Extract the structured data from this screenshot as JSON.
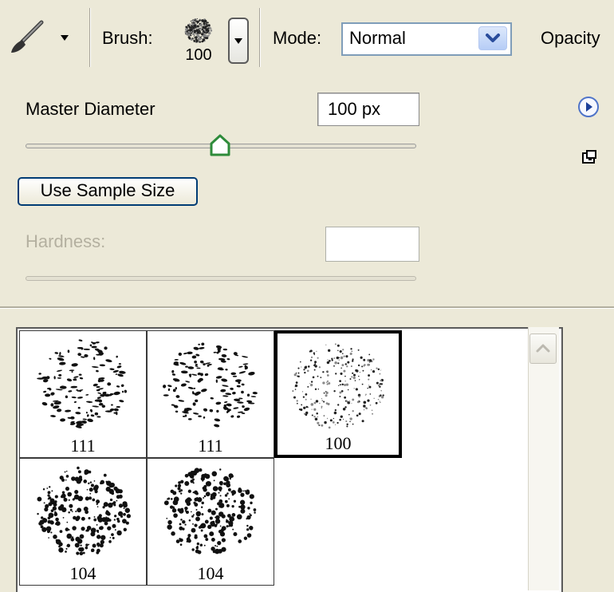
{
  "toolbar": {
    "tool_icon": "brush-icon",
    "brush_label": "Brush:",
    "brush_size": "100",
    "mode_label": "Mode:",
    "mode_value": "Normal",
    "opacity_label": "Opacity"
  },
  "panel": {
    "master_diameter_label": "Master Diameter",
    "master_diameter_value": "100 px",
    "master_diameter_slider_fraction": 0.5,
    "use_sample_size_label": "Use Sample Size",
    "hardness_label": "Hardness:",
    "hardness_value": "",
    "flyout_icon": "play-arrow-icon",
    "new_preset_icon": "new-preset-icon"
  },
  "brushes": [
    {
      "size": "111",
      "style": "strokes",
      "selected": false
    },
    {
      "size": "111",
      "style": "strokes",
      "selected": false
    },
    {
      "size": "100",
      "style": "dots",
      "selected": true
    },
    {
      "size": "104",
      "style": "spatter",
      "selected": false
    },
    {
      "size": "104",
      "style": "spatter",
      "selected": false
    }
  ],
  "colors": {
    "background": "#ece9d8",
    "accent": "#316ac5",
    "slider_thumb": "#2e8b3a"
  }
}
